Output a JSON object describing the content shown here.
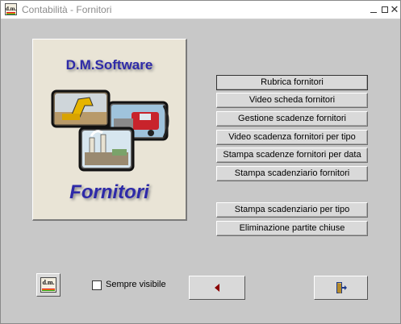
{
  "window": {
    "title": "Contabilità - Fornitori",
    "app_icon_text": "d.m."
  },
  "splash": {
    "brand": "D.M.Software",
    "title": "Fornitori"
  },
  "menu": {
    "group1": [
      {
        "label": "Rubrica fornitori",
        "focused": true
      },
      {
        "label": "Video scheda fornitori"
      },
      {
        "label": "Gestione scadenze fornitori"
      },
      {
        "label": "Video scadenza fornitori per tipo"
      },
      {
        "label": "Stampa scadenze fornitori per data"
      },
      {
        "label": "Stampa scadenziario fornitori"
      }
    ],
    "group2": [
      {
        "label": "Stampa scadenziario per tipo"
      },
      {
        "label": "Eliminazione partite chiuse"
      }
    ]
  },
  "footer": {
    "logo_button_text": "d.m.",
    "always_visible_label": "Sempre visibile",
    "always_visible_checked": false,
    "back_icon": "arrow-left-icon",
    "exit_icon": "exit-door-icon"
  },
  "colors": {
    "window_bg": "#c8c8c8",
    "button_face": "#d9d9d9",
    "brand_blue": "#2e2aa8",
    "back_arrow": "#8b0000"
  }
}
